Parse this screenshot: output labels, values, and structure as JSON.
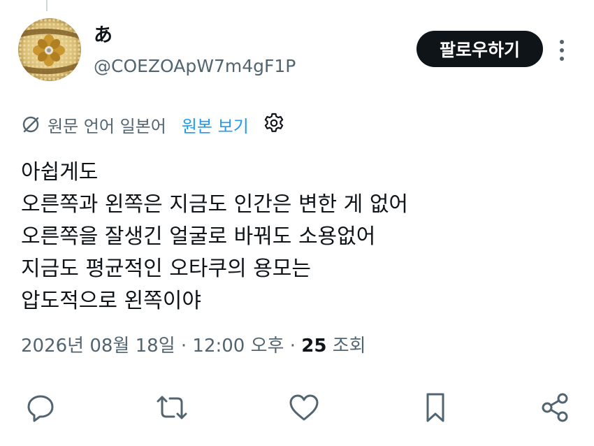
{
  "user": {
    "display_name": "あ",
    "handle": "@COEZOApW7m4gF1P"
  },
  "follow_button": {
    "label": "팔로우하기"
  },
  "translation": {
    "source_language": "원문 언어 일본어",
    "show_original": "원본 보기"
  },
  "tweet": {
    "lines": [
      "아쉽게도",
      "오른쪽과 왼쪽은 지금도 인간은 변한 게 없어",
      "오른쪽을 잘생긴 얼굴로 바꿔도 소용없어",
      "지금도 평균적인 오타쿠의 용모는",
      "압도적으로 왼쪽이야"
    ]
  },
  "meta": {
    "timestamp": "2026년 08월 18일 · 12:00 오후 · ",
    "view_count": "25",
    "view_label": " 조회"
  },
  "icons": {
    "translate": "translate-icon",
    "settings": "gear-icon",
    "more": "more-vertical-icon",
    "reply": "reply-icon",
    "retweet": "retweet-icon",
    "like": "heart-icon",
    "bookmark": "bookmark-icon",
    "share": "share-icon"
  },
  "colors": {
    "text": "#0f1419",
    "secondary": "#536471",
    "link": "#1d9bf0",
    "button_bg": "#0f1419"
  }
}
